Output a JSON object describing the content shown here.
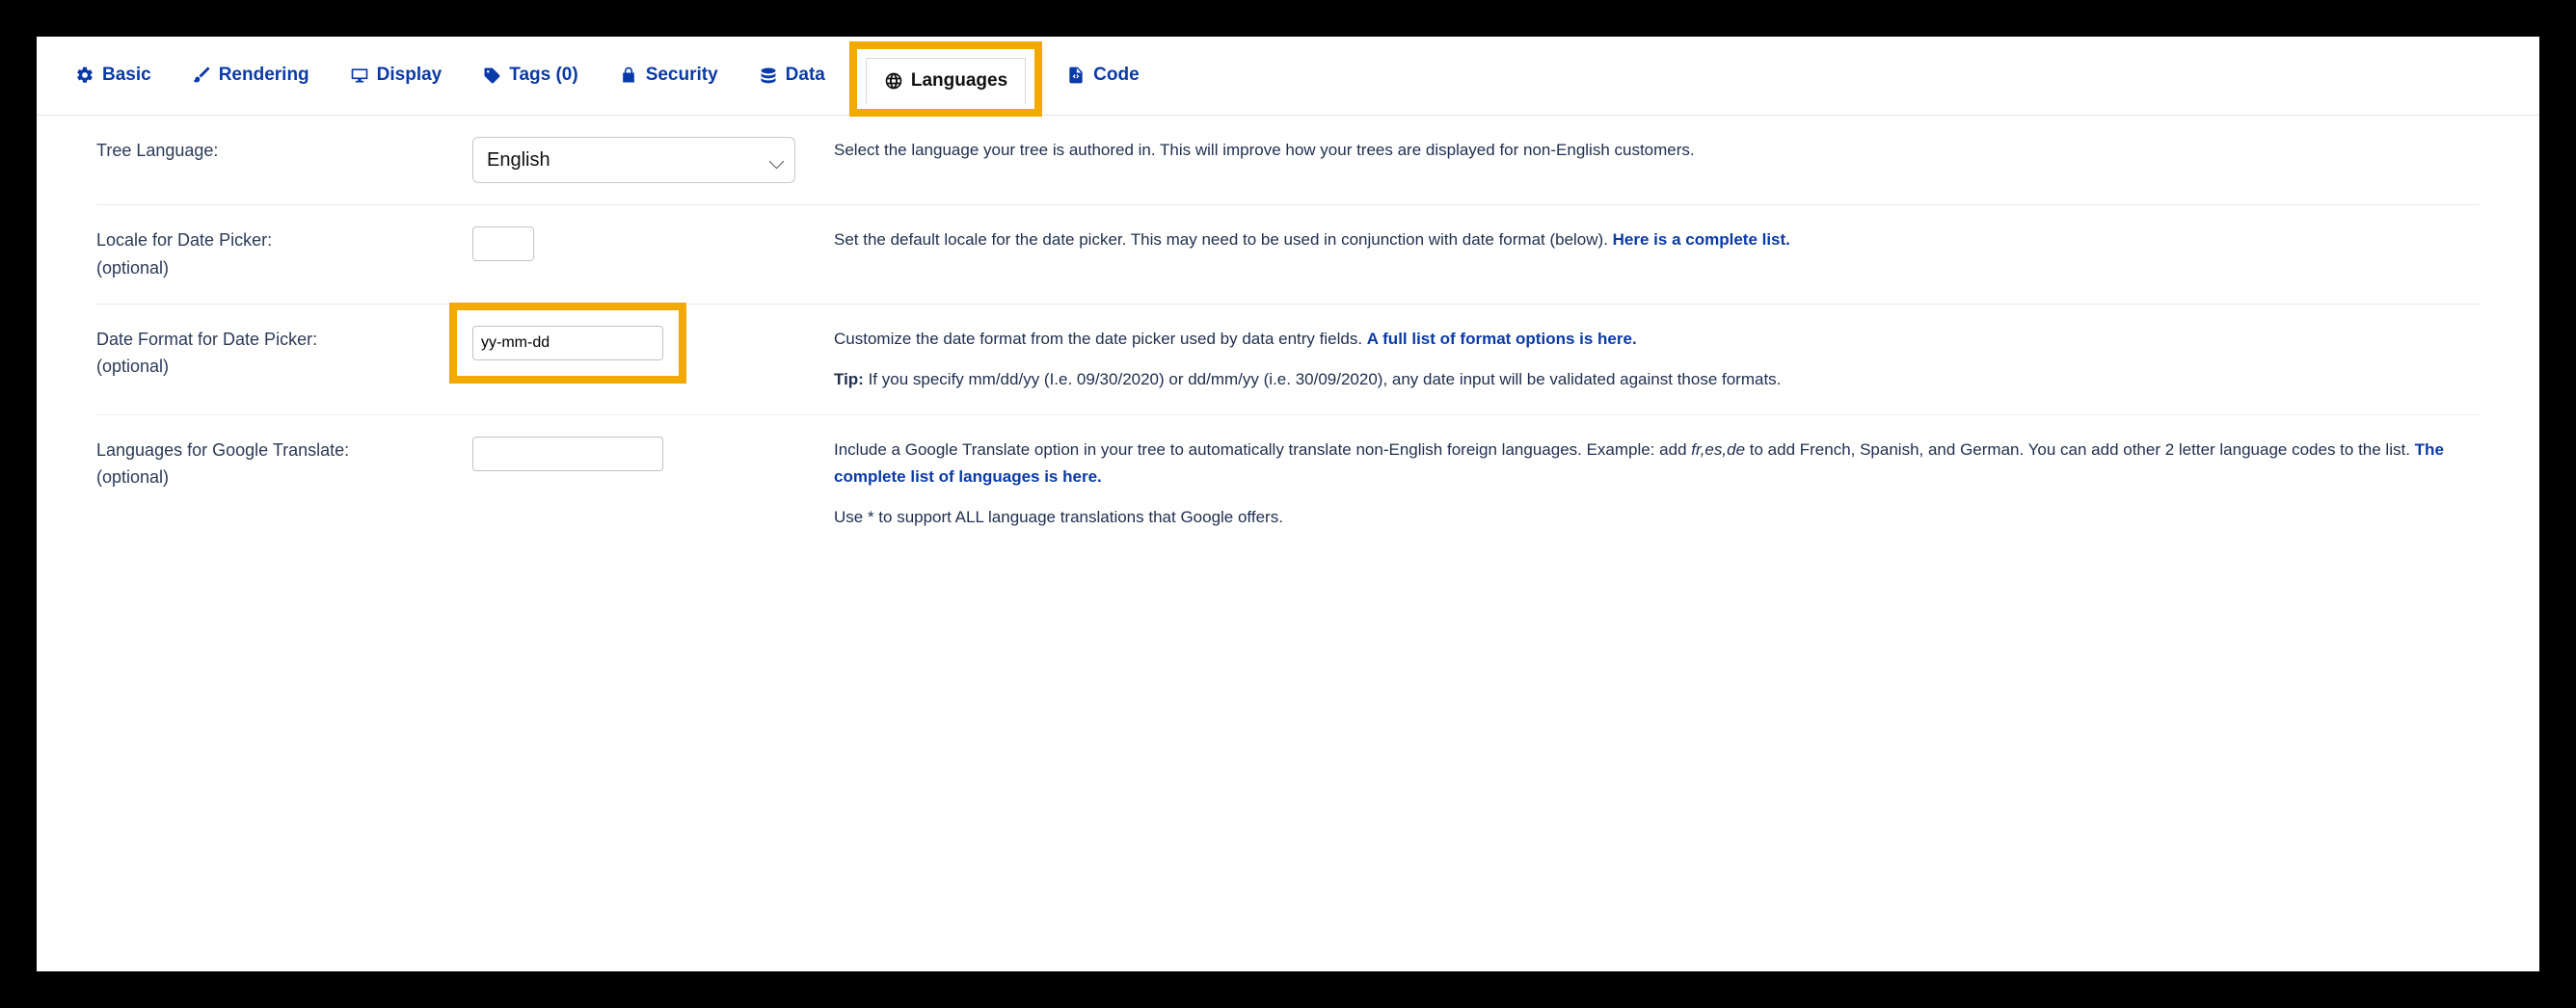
{
  "colors": {
    "accent": "#0a3aa8",
    "callout": "#f2a900"
  },
  "tabs": {
    "basic": {
      "label": "Basic",
      "icon": "gear-icon"
    },
    "rendering": {
      "label": "Rendering",
      "icon": "brush-icon"
    },
    "display": {
      "label": "Display",
      "icon": "monitor-icon"
    },
    "tags": {
      "label": "Tags (0)",
      "icon": "tag-icon"
    },
    "security": {
      "label": "Security",
      "icon": "lock-icon"
    },
    "data": {
      "label": "Data",
      "icon": "database-icon"
    },
    "languages": {
      "label": "Languages",
      "icon": "globe-icon",
      "active": true
    },
    "code": {
      "label": "Code",
      "icon": "code-file-icon"
    }
  },
  "rows": {
    "treeLanguage": {
      "label": "Tree Language:",
      "value": "English",
      "help": "Select the language your tree is authored in. This will improve how your trees are displayed for non-English customers."
    },
    "locale": {
      "label": "Locale for Date Picker:",
      "sublabel": "(optional)",
      "value": "",
      "help_prefix": "Set the default locale for the date picker. This may need to be used in conjunction with date format (below). ",
      "help_link": "Here is a complete list."
    },
    "dateFormat": {
      "label": "Date Format for Date Picker:",
      "sublabel": "(optional)",
      "value": "yy-mm-dd",
      "help_prefix": "Customize the date format from the date picker used by data entry fields. ",
      "help_link": "A full list of format options is here.",
      "tip_label": "Tip:",
      "tip_text": " If you specify mm/dd/yy (I.e. 09/30/2020) or dd/mm/yy (i.e. 30/09/2020), any date input will be validated against those formats."
    },
    "googleTranslate": {
      "label": "Languages for Google Translate:",
      "sublabel": "(optional)",
      "value": "",
      "help_prefix": "Include a Google Translate option in your tree to automatically translate non-English foreign languages. Example: add ",
      "help_em": "fr,es,de",
      "help_mid": " to add French, Spanish, and German. You can add other 2 letter language codes to the list. ",
      "help_link": "The complete list of languages is here.",
      "help_extra": "Use * to support ALL language translations that Google offers."
    }
  }
}
